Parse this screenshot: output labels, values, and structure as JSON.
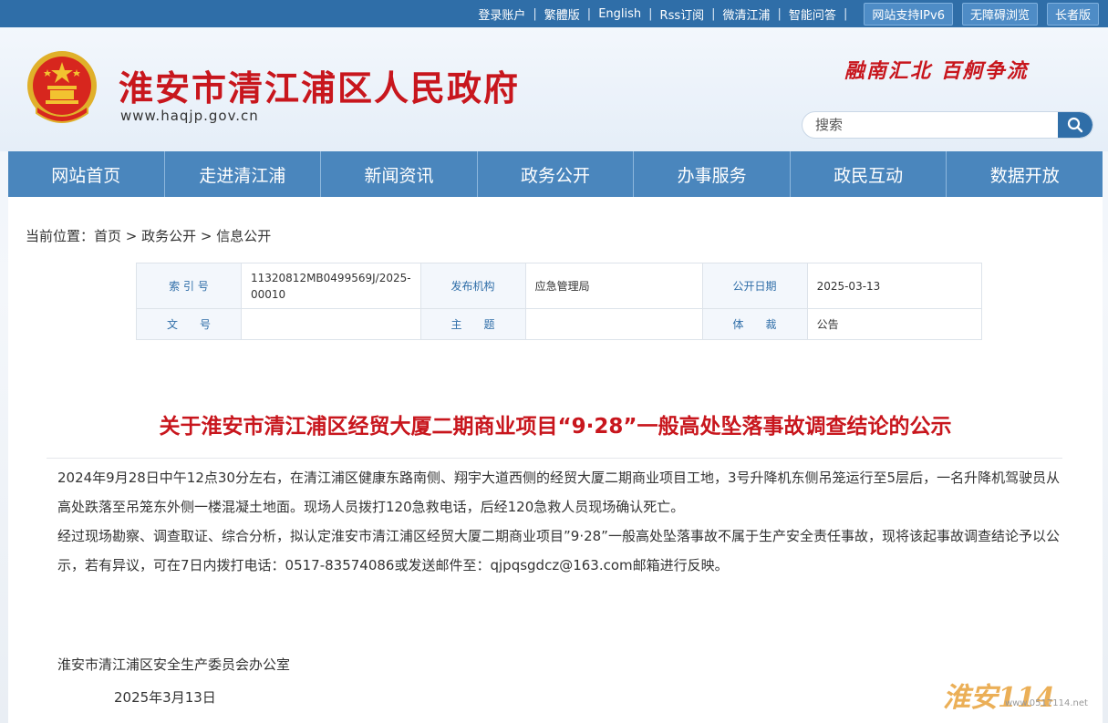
{
  "topbar": {
    "links": [
      "登录账户",
      "繁體版",
      "English",
      "Rss订阅",
      "微清江浦",
      "智能问答"
    ],
    "ipv6": "网站支持IPv6",
    "accessible": "无障碍浏览",
    "elder": "长者版"
  },
  "header": {
    "title": "淮安市清江浦区人民政府",
    "url": "www.haqjp.gov.cn",
    "slogan": "融南汇北  百舸争流",
    "search_placeholder": "搜索"
  },
  "nav": [
    "网站首页",
    "走进清江浦",
    "新闻资讯",
    "政务公开",
    "办事服务",
    "政民互动",
    "数据开放"
  ],
  "breadcrumb": {
    "prefix": "当前位置：",
    "items": [
      "首页",
      "政务公开",
      "信息公开"
    ],
    "sep": " > "
  },
  "meta": {
    "index_label": "索 引 号",
    "index_value": "11320812MB0499569J/2025-00010",
    "org_label": "发布机构",
    "org_value": "应急管理局",
    "date_label": "公开日期",
    "date_value": "2025-03-13",
    "docno_label": "文　　号",
    "docno_value": "",
    "topic_label": "主　　题",
    "topic_value": "",
    "genre_label": "体　　裁",
    "genre_value": "公告"
  },
  "article": {
    "title": "关于淮安市清江浦区经贸大厦二期商业项目“9·28”一般高处坠落事故调查结论的公示",
    "p1": "2024年9月28日中午12点30分左右，在清江浦区健康东路南侧、翔宇大道西侧的经贸大厦二期商业项目工地，3号升降机东侧吊笼运行至5层后，一名升降机驾驶员从高处跌落至吊笼东外侧一楼混凝土地面。现场人员拨打120急救电话，后经120急救人员现场确认死亡。",
    "p2": "经过现场勘察、调查取证、综合分析，拟认定淮安市清江浦区经贸大厦二期商业项目”9·28”一般高处坠落事故不属于生产安全责任事故，现将该起事故调查结论予以公示，若有异议，可在7日内拨打电话：0517-83574086或发送邮件至：qjpqsgdcz@163.com邮箱进行反映。",
    "signer": "淮安市清江浦区安全生产委员会办公室",
    "sign_date": "2025年3月13日"
  },
  "watermark": {
    "main": "淮安114",
    "sub": "www.0517114.net"
  },
  "colors": {
    "brand_red": "#c8161d",
    "brand_blue": "#2f6ea8",
    "nav_blue": "#4a86bd"
  }
}
